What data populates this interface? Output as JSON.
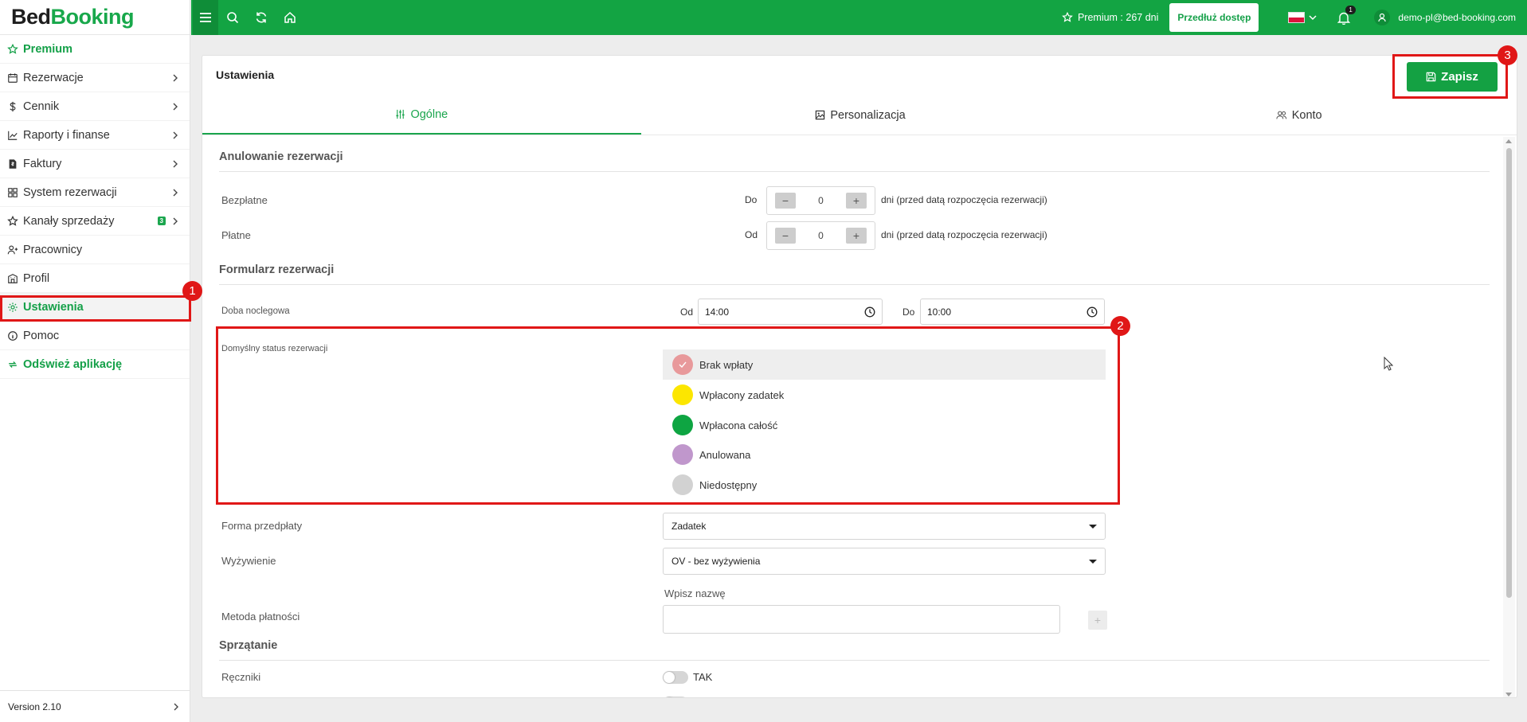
{
  "app": {
    "logo_part1": "Bed",
    "logo_part2": "Booking",
    "version": "Version 2.10"
  },
  "sidebar": {
    "items": [
      {
        "label": "Premium",
        "icon": "star-icon"
      },
      {
        "label": "Rezerwacje",
        "icon": "calendar-icon"
      },
      {
        "label": "Cennik",
        "icon": "dollar-icon"
      },
      {
        "label": "Raporty i finanse",
        "icon": "chart-icon"
      },
      {
        "label": "Faktury",
        "icon": "invoice-icon"
      },
      {
        "label": "System rezerwacji",
        "icon": "grid-icon"
      },
      {
        "label": "Kanały sprzedaży",
        "icon": "star-icon",
        "badge": "3"
      },
      {
        "label": "Pracownicy",
        "icon": "users-icon"
      },
      {
        "label": "Profil",
        "icon": "building-icon"
      },
      {
        "label": "Ustawienia",
        "icon": "gear-icon"
      },
      {
        "label": "Pomoc",
        "icon": "info-icon"
      },
      {
        "label": "Odśwież aplikację",
        "icon": "refresh-icon"
      }
    ]
  },
  "topbar": {
    "premium_text": "Premium : 267 dni",
    "extend_button": "Przedłuż dostęp",
    "notifications_count": "1",
    "user_email": "demo-pl@bed-booking.com",
    "accent": "#13a443"
  },
  "card": {
    "title": "Ustawienia",
    "save_button": "Zapisz",
    "tabs": [
      {
        "label": "Ogólne"
      },
      {
        "label": "Personalizacja"
      },
      {
        "label": "Konto"
      }
    ]
  },
  "cancel": {
    "heading": "Anulowanie rezerwacji",
    "free_label": "Bezpłatne",
    "free_prefix": "Do",
    "free_value": "0",
    "paid_label": "Płatne",
    "paid_prefix": "Od",
    "paid_value": "0",
    "suffix": "dni (przed datą rozpoczęcia rezerwacji)"
  },
  "form": {
    "heading": "Formularz rezerwacji",
    "night_label": "Doba noclegowa",
    "from_prefix": "Od",
    "from_value": "14:00",
    "to_prefix": "Do",
    "to_value": "10:00",
    "status_label": "Domyślny status rezerwacji",
    "statuses": [
      {
        "label": "Brak wpłaty",
        "color": "#e8999b",
        "selected": true
      },
      {
        "label": "Wpłacony zadatek",
        "color": "#fce600",
        "selected": false
      },
      {
        "label": "Wpłacona całość",
        "color": "#0ea542",
        "selected": false
      },
      {
        "label": "Anulowana",
        "color": "#c097cc",
        "selected": false
      },
      {
        "label": "Niedostępny",
        "color": "#d2d2d2",
        "selected": false
      }
    ],
    "prepay_label": "Forma przedpłaty",
    "prepay_value": "Zadatek",
    "meal_label": "Wyżywienie",
    "meal_value": "OV - bez wyżywienia",
    "payment_hint": "Wpisz nazwę",
    "payment_label": "Metoda płatności",
    "payment_value": ""
  },
  "cleaning": {
    "heading": "Sprzątanie",
    "towels_label": "Ręczniki",
    "towels_toggle": "TAK"
  },
  "annotations": [
    "1",
    "2",
    "3"
  ]
}
